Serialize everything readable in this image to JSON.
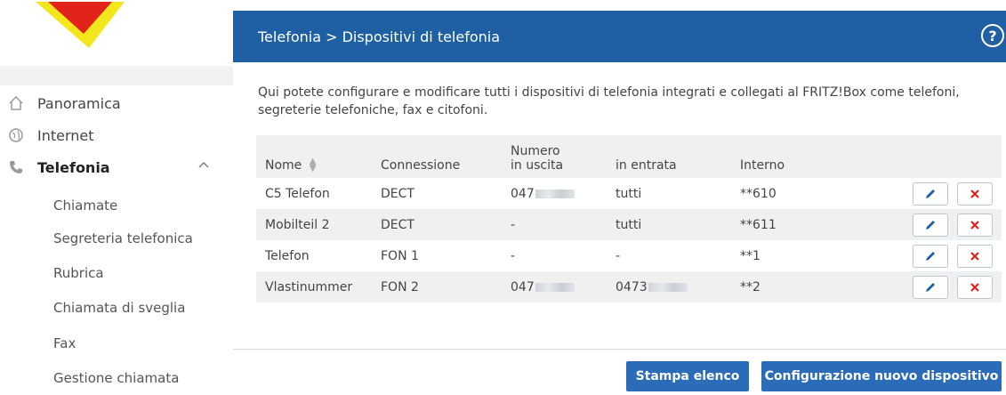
{
  "header": {
    "breadcrumb": "Telefonia > Dispositivi di telefonia",
    "help_label": "?"
  },
  "sidebar": {
    "items": [
      {
        "label": "Panoramica",
        "icon": "home-icon"
      },
      {
        "label": "Internet",
        "icon": "globe-icon"
      },
      {
        "label": "Telefonia",
        "icon": "phone-icon",
        "active": true,
        "expanded": true
      }
    ],
    "sub_items": [
      {
        "label": "Chiamate"
      },
      {
        "label": "Segreteria telefonica"
      },
      {
        "label": "Rubrica"
      },
      {
        "label": "Chiamata di sveglia"
      },
      {
        "label": "Fax"
      },
      {
        "label": "Gestione chiamata"
      }
    ]
  },
  "main": {
    "intro": "Qui potete configurare e modificare tutti i dispositivi di telefonia integrati e collegati al FRITZ!Box come telefoni, segreterie telefoniche, fax e citofoni.",
    "table": {
      "columns": {
        "name": "Nome",
        "connection": "Connessione",
        "number_group": "Numero",
        "outgoing": "in uscita",
        "incoming": "in entrata",
        "internal": "Interno"
      },
      "rows": [
        {
          "name": "C5 Telefon",
          "connection": "DECT",
          "outgoing": "047",
          "incoming": "tutti",
          "internal": "**610"
        },
        {
          "name": "Mobilteil 2",
          "connection": "DECT",
          "outgoing": "-",
          "incoming": "tutti",
          "internal": "**611"
        },
        {
          "name": "Telefon",
          "connection": "FON 1",
          "outgoing": "-",
          "incoming": "-",
          "internal": "**1"
        },
        {
          "name": "Vlastinummer",
          "connection": "FON 2",
          "outgoing": "047",
          "incoming": "0473",
          "internal": "**2"
        }
      ]
    },
    "buttons": {
      "print": "Stampa elenco",
      "new_device": "Configurazione nuovo dispositivo"
    }
  },
  "colors": {
    "header_blue": "#1f5fa3",
    "button_blue": "#2b6cb8",
    "delete_red": "#d9251d",
    "edit_blue": "#1f5fa3"
  }
}
